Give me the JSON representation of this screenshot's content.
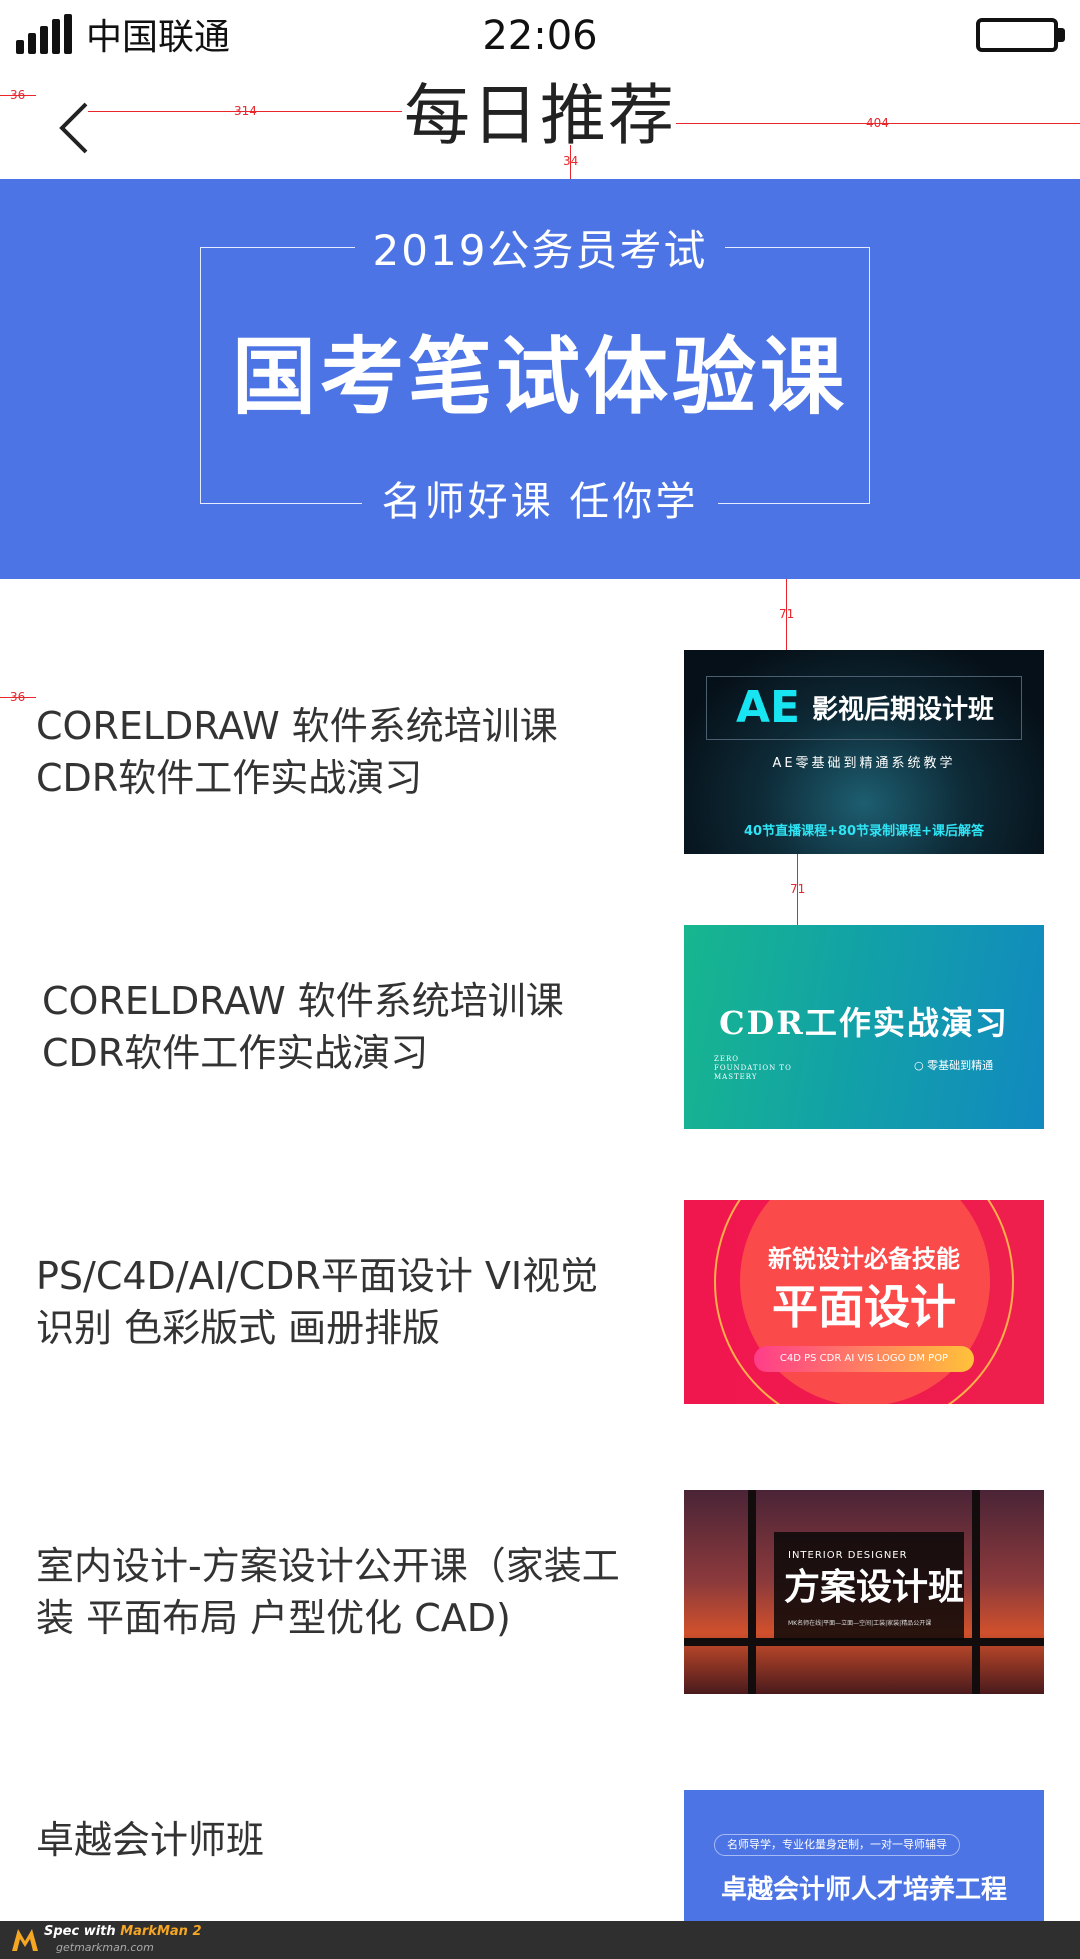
{
  "status_bar": {
    "carrier": "中国联通",
    "time": "22:06"
  },
  "nav": {
    "title": "每日推荐"
  },
  "spec_marks": {
    "margin_left": "36",
    "title_left": "314",
    "title_right": "404",
    "title_gap": "34",
    "banner_gap": "71",
    "item_gap": "71"
  },
  "banner": {
    "top_text": "2019公务员考试",
    "main_text": "国考笔试体验课",
    "bottom_text": "名师好课 任你学"
  },
  "courses": [
    {
      "title": "CORELDRAW 软件系统培训课 CDR软件工作实战演习",
      "thumb": {
        "accent": "AE",
        "title": "影视后期设计班",
        "sub": "AE零基础到精通系统教学",
        "bottom": "40节直播课程+80节录制课程+课后解答"
      }
    },
    {
      "title": "CORELDRAW 软件系统培训课 CDR软件工作实战演习",
      "thumb": {
        "title": "CDR工作实战演习",
        "en": "ZERO FOUNDATION TO MASTERY",
        "note": "○ 零基础到精通"
      }
    },
    {
      "title": "PS/C4D/AI/CDR平面设计 VI视觉识别 色彩版式 画册排版",
      "thumb": {
        "line1": "新锐设计必备技能",
        "line2": "平面设计",
        "pill": "C4D  PS  CDR  AI  VIS LOGO  DM  POP"
      }
    },
    {
      "title": "室内设计-方案设计公开课（家装工装 平面布局 户型优化  CAD)",
      "thumb": {
        "en": "INTERIOR DESIGNER",
        "title": "方案设计班",
        "small": "MK名师在线|平面—立面—空间|工装|家装|精品公开课"
      }
    },
    {
      "title": "卓越会计师班",
      "thumb": {
        "tag": "名师导学，专业化量身定制，一对一导师辅导",
        "title": "卓越会计师人才培养工程"
      }
    }
  ],
  "footer": {
    "prefix": "Spec with ",
    "brand": "MarkMan 2",
    "url": "getmarkman.com"
  },
  "colors": {
    "banner_blue": "#4c74e4",
    "spec_red": "#e8262b",
    "text": "#333333"
  }
}
